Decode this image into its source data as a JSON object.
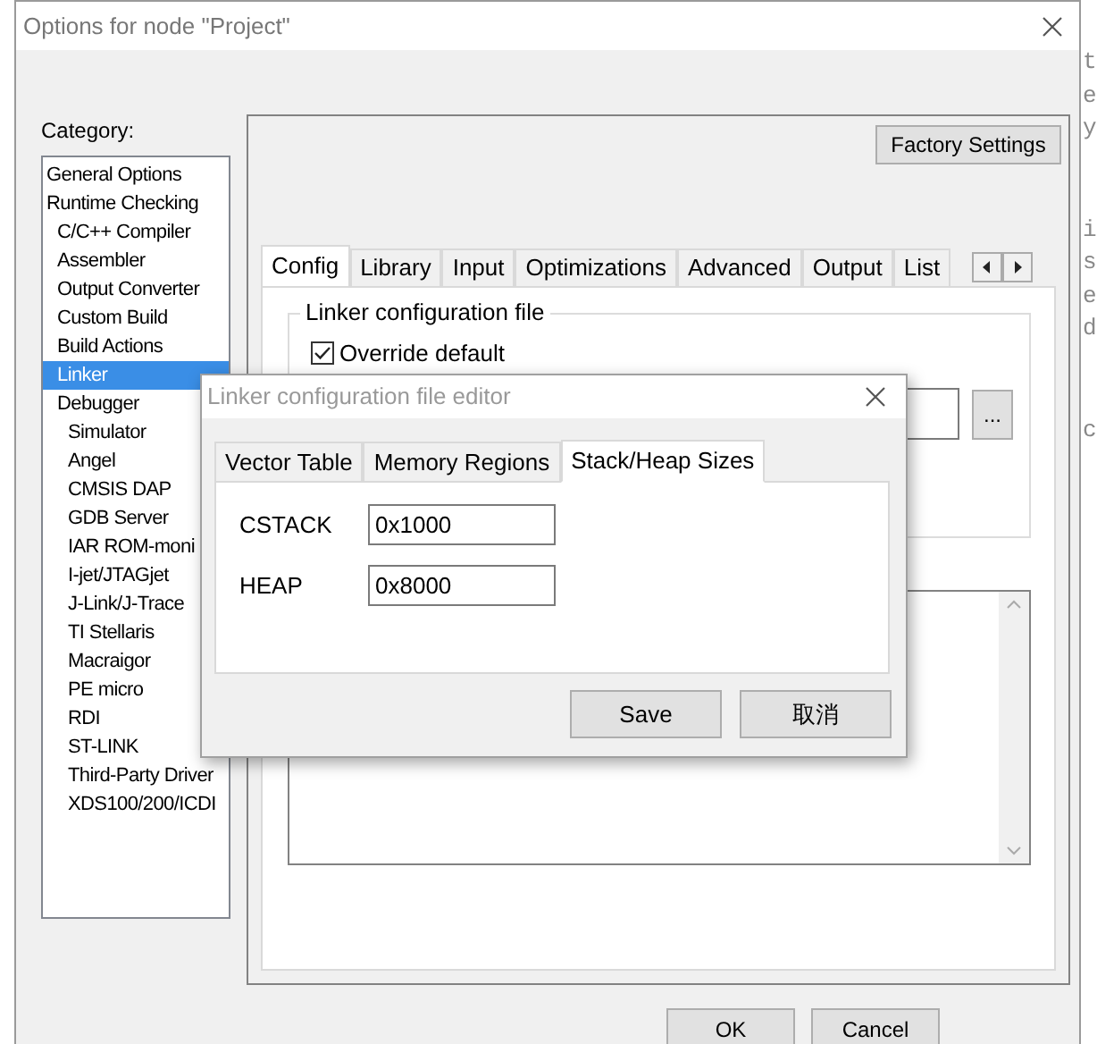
{
  "background_editor": {
    "line_groups": [
      [
        "t",
        "e",
        "y"
      ],
      [
        "i",
        "s",
        "e",
        "d"
      ],
      [
        "c"
      ]
    ]
  },
  "window": {
    "title": "Options for node \"Project\""
  },
  "category": {
    "label": "Category:",
    "items": [
      {
        "label": "General Options",
        "selected": false
      },
      {
        "label": "Runtime Checking",
        "selected": false,
        "children": [
          {
            "label": "C/C++ Compiler",
            "selected": false
          },
          {
            "label": "Assembler",
            "selected": false
          },
          {
            "label": "Output Converter",
            "selected": false
          },
          {
            "label": "Custom Build",
            "selected": false
          },
          {
            "label": "Build Actions",
            "selected": false
          },
          {
            "label": "Linker",
            "selected": true
          },
          {
            "label": "Debugger",
            "selected": false,
            "children": [
              {
                "label": "Simulator",
                "selected": false
              },
              {
                "label": "Angel",
                "selected": false
              },
              {
                "label": "CMSIS DAP",
                "selected": false
              },
              {
                "label": "GDB Server",
                "selected": false
              },
              {
                "label": "IAR ROM-moni",
                "selected": false
              },
              {
                "label": "I-jet/JTAGjet",
                "selected": false
              },
              {
                "label": "J-Link/J-Trace",
                "selected": false
              },
              {
                "label": "TI Stellaris",
                "selected": false
              },
              {
                "label": "Macraigor",
                "selected": false
              },
              {
                "label": "PE micro",
                "selected": false
              },
              {
                "label": "RDI",
                "selected": false
              },
              {
                "label": "ST-LINK",
                "selected": false
              },
              {
                "label": "Third-Party Driver",
                "selected": false
              },
              {
                "label": "XDS100/200/ICDI",
                "selected": false
              }
            ]
          }
        ]
      }
    ]
  },
  "factory_settings_button": "Factory Settings",
  "tabs": [
    {
      "label": "Config",
      "selected": true
    },
    {
      "label": "Library",
      "selected": false
    },
    {
      "label": "Input",
      "selected": false
    },
    {
      "label": "Optimizations",
      "selected": false
    },
    {
      "label": "Advanced",
      "selected": false
    },
    {
      "label": "Output",
      "selected": false
    },
    {
      "label": "List",
      "selected": false
    }
  ],
  "config": {
    "group_title": "Linker configuration file",
    "override_default": {
      "label": "Override default",
      "checked": true
    },
    "browse_button": "..."
  },
  "buttons": [
    "OK",
    "Cancel"
  ],
  "editor_dialog": {
    "title": "Linker configuration file editor",
    "tabs": [
      {
        "label": "Vector Table",
        "selected": false
      },
      {
        "label": "Memory Regions",
        "selected": false
      },
      {
        "label": "Stack/Heap Sizes",
        "selected": true
      }
    ],
    "fields": [
      {
        "label": "CSTACK",
        "value": "0x1000"
      },
      {
        "label": "HEAP",
        "value": "0x8000"
      }
    ],
    "buttons": [
      "Save",
      "取消"
    ]
  }
}
